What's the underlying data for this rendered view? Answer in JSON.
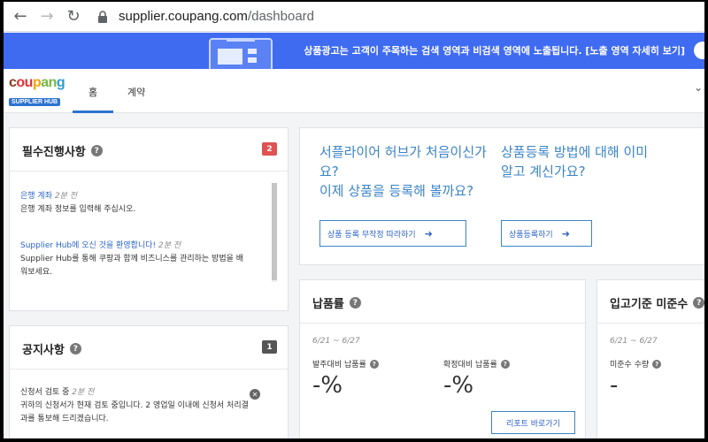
{
  "browser": {
    "url_host": "supplier.coupang.com",
    "url_path": "/dashboard"
  },
  "banner": {
    "text": "상품광고는 고객이 주목하는 검색 영역과 비검색 영역에 노출됩니다. [노출 영역 자세히 보기]"
  },
  "header": {
    "logo_word": [
      "c",
      "ou",
      "p",
      "an",
      "g"
    ],
    "logo_badge": "SUPPLIER HUB",
    "tabs": [
      {
        "label": "홈",
        "active": true
      },
      {
        "label": "계약",
        "active": false
      }
    ]
  },
  "required": {
    "title": "필수진행사항",
    "count": "2",
    "badge_color": "#e05252",
    "items": [
      {
        "link": "은행 계좌",
        "time": "2분 전",
        "body": "은행 계좌 정보를 입력해 주십시오."
      },
      {
        "link": "Supplier Hub에 오신 것을 환영합니다!",
        "time": "2분 전",
        "body": "Supplier Hub를 통해 쿠팡과 함께 비즈니스를 관리하는 방법을 배워보세요."
      }
    ]
  },
  "notices": {
    "title": "공지사항",
    "count": "1",
    "badge_color": "#555555",
    "items": [
      {
        "title": "신청서 검토 중",
        "time": "2분 전",
        "body": "귀하의 신청서가 현재 검토 중입니다. 2 영업일 이내에 신청서 처리결과를 통보해 드리겠습니다."
      }
    ]
  },
  "welcome": {
    "first_question": "서플라이어 허브가 처음이신가요?\n이제 상품을 등록해 볼까요?",
    "first_button": "상품 등록 무작정 따라하기",
    "second_question": "상품등록 방법에 대해 이미 알고 계신가요?",
    "second_button": "상품등록하기"
  },
  "delivery_rate": {
    "title": "납품률",
    "range": "6/21 ~ 6/27",
    "metric1_label": "발주대비 납품률",
    "metric1_value": "-%",
    "metric2_label": "확정대비 납품률",
    "metric2_value": "-%",
    "report_button": "리포트 바로가기"
  },
  "inbound_miss": {
    "title": "입고기준 미준수",
    "range": "6/21 ~ 6/27",
    "metric_label": "미준수 수량",
    "metric_value": "-"
  },
  "colors": {
    "accent": "#2c73d2",
    "banner": "#3f6bf1",
    "link": "#2c63c9"
  }
}
